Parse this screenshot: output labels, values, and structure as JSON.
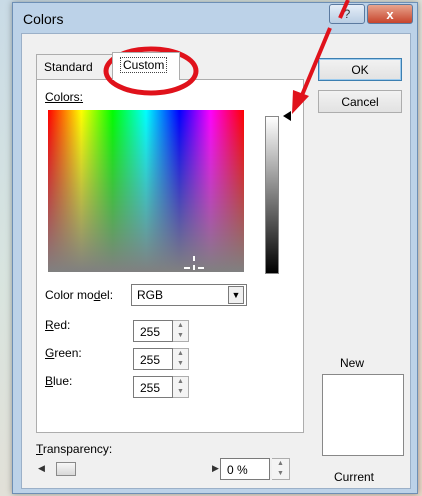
{
  "dialog": {
    "title": "Colors",
    "help_label": "?",
    "close_label": "x"
  },
  "tabs": [
    {
      "label": "Standard",
      "selected": false
    },
    {
      "label": "Custom",
      "selected": true
    }
  ],
  "custom": {
    "colors_label": "Colors:",
    "color_model_label": "Color model:",
    "color_model_value": "RGB",
    "red_label": "Red:",
    "red_value": "255",
    "green_label": "Green:",
    "green_value": "255",
    "blue_label": "Blue:",
    "blue_value": "255"
  },
  "transparency": {
    "label": "Transparency:",
    "value": "0 %",
    "slider_level": 0
  },
  "buttons": {
    "ok": "OK",
    "cancel": "Cancel"
  },
  "preview": {
    "new_label": "New",
    "current_label": "Current",
    "new_color": "#ffffff"
  },
  "icons": {
    "spin_up": "▲",
    "spin_down": "▼",
    "dropdown": "▼",
    "slider_left": "◀",
    "slider_right": "▶"
  },
  "annotation_color": "#e0121b"
}
